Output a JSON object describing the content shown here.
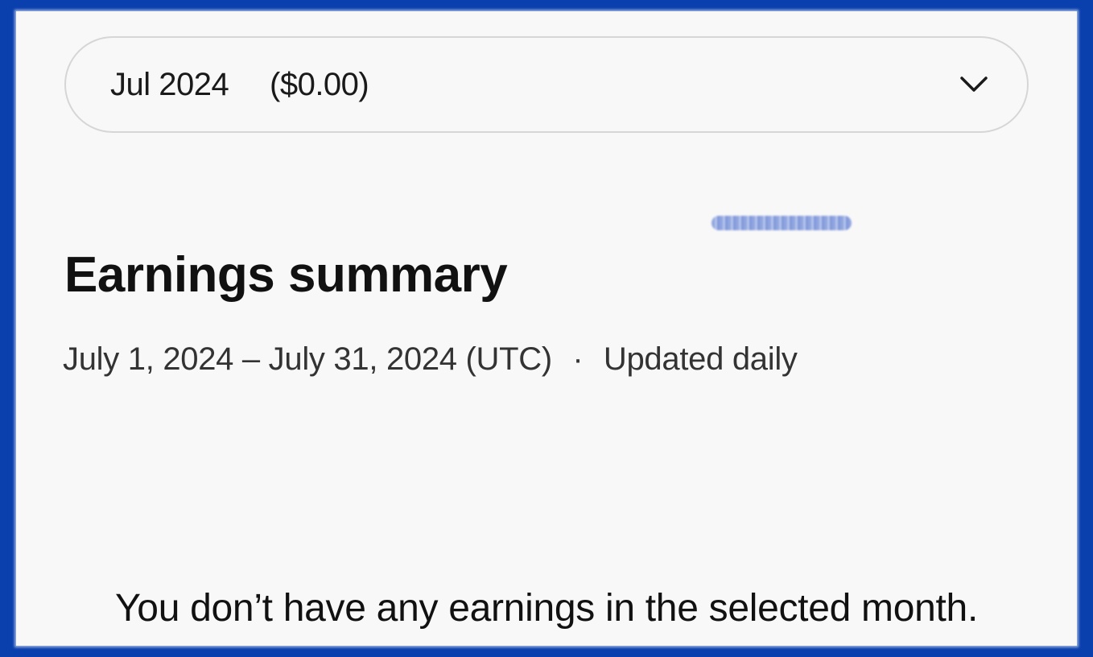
{
  "month_selector": {
    "month": "Jul 2024",
    "amount": "($0.00)",
    "icon": "chevron-down-icon"
  },
  "summary": {
    "title": "Earnings summary",
    "date_range": "July 1, 2024 – July 31, 2024 (UTC)",
    "separator": "·",
    "update_note": "Updated daily"
  },
  "empty_state": {
    "message": "You don’t have any earnings in the selected month."
  },
  "colors": {
    "frame_border": "#0a3fae",
    "card_background": "#f8f8f8",
    "select_border": "#d6d6d6",
    "text_primary": "#111111",
    "text_secondary": "#333333"
  }
}
